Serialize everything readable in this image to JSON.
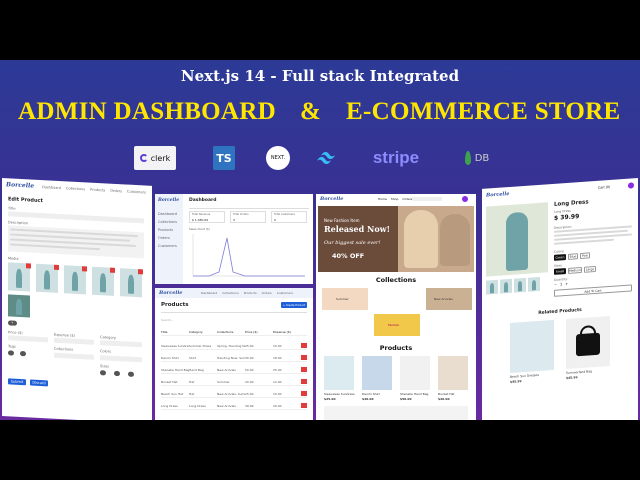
{
  "header": {
    "subtitle": "Next.js 14 - Full stack Integrated",
    "title_left": "ADMIN DASHBOARD",
    "title_amp": "&",
    "title_right": "E-COMMERCE STORE"
  },
  "logos": {
    "clerk": "clerk",
    "ts": "TS",
    "next": "NEXT.",
    "stripe": "stripe",
    "mongo": "DB"
  },
  "edit_product": {
    "brand": "Borcelle",
    "nav": [
      "Dashboard",
      "Collections",
      "Products",
      "Orders",
      "Customers"
    ],
    "page_title": "Edit Product",
    "labels": {
      "title": "Title",
      "description": "Description",
      "media": "Media",
      "price": "Price ($)",
      "expense": "Expense ($)",
      "category": "Category",
      "collections": "Collections",
      "tags": "Tags",
      "colors": "Colors",
      "sizes": "Sizes"
    },
    "submit": "Submit",
    "discard": "Discard"
  },
  "dashboard": {
    "brand": "Borcelle",
    "sidebar": [
      "Dashboard",
      "Collections",
      "Products",
      "Orders",
      "Customers"
    ],
    "title": "Dashboard",
    "cards": [
      {
        "label": "Total Revenue",
        "value": "$ 1,450.00"
      },
      {
        "label": "Total Orders",
        "value": "3"
      },
      {
        "label": "Total Customers",
        "value": "2"
      }
    ],
    "chart_title": "Sales Chart ($)"
  },
  "products_table": {
    "brand": "Borcelle",
    "nav": [
      "Dashboard",
      "Collections",
      "Products",
      "Orders",
      "Customers"
    ],
    "title": "Products",
    "create_button": "+ Create Product",
    "search_placeholder": "Search...",
    "columns": [
      "Title",
      "Category",
      "Collections",
      "Price ($)",
      "Expense ($)",
      ""
    ],
    "rows": [
      [
        "Sleeveless Sundress",
        "Summer Dress",
        "Spring, Trending Now, Summer",
        "25.00",
        "15.00"
      ],
      [
        "Denim Shirt",
        "Shirt",
        "Trending Now, Summer",
        "30.00",
        "18.00"
      ],
      [
        "Sheoelle Hand Bag",
        "Hand Bag",
        "New Arrivals",
        "50.00",
        "25.00"
      ],
      [
        "Bucket Hat",
        "Hat",
        "Summer",
        "20.00",
        "12.00"
      ],
      [
        "Beach Sun Hat",
        "Hat",
        "New Arrivals, Summer",
        "25.00",
        "15.00"
      ],
      [
        "Long Dress",
        "Long Dress",
        "New Arrivals",
        "39.99",
        "20.00"
      ]
    ]
  },
  "store": {
    "brand": "Borcelle",
    "nav": [
      "Home",
      "Shop",
      "Orders"
    ],
    "hero_line1": "New Fashion Item",
    "hero_line2": "Released Now!",
    "hero_line3": "Our biggest sale ever!",
    "hero_line4": "40% OFF",
    "collections_title": "Collections",
    "collection_tiles": [
      "Summer",
      "New Arrivals",
      "Fashion"
    ],
    "products_title": "Products",
    "products": [
      {
        "name": "Sleeveless Sundress",
        "price": "$25.00"
      },
      {
        "name": "Denim Shirt",
        "price": "$30.00"
      },
      {
        "name": "Sheoelle Hand Bag",
        "price": "$50.00"
      },
      {
        "name": "Bucket Hat",
        "price": "$20.00"
      }
    ]
  },
  "product_page": {
    "brand": "Borcelle",
    "cart": "Cart (0)",
    "name": "Long Dress",
    "category": "Long Dress",
    "price": "$ 39.99",
    "desc_label": "Description:",
    "colors_label": "Colors:",
    "colors": [
      "Green",
      "Blue",
      "Pink"
    ],
    "sizes_label": "Sizes:",
    "sizes": [
      "Small",
      "Medium",
      "Large"
    ],
    "quantity_label": "Quantity:",
    "quantity": "1",
    "add_to_cart": "Add To Cart",
    "related_title": "Related Products",
    "related": [
      {
        "name": "Beach Sun Dresses",
        "price": "$45.99"
      },
      {
        "name": "Summerland Bag",
        "price": "$45.99"
      }
    ]
  }
}
